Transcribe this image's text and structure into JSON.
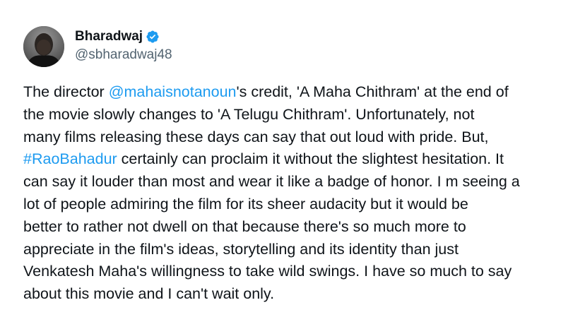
{
  "author": {
    "display_name": "Bharadwaj",
    "handle": "@sbharadwaj48",
    "verified_badge_icon": "verified-badge-icon",
    "avatar": "avatar-photo"
  },
  "tweet": {
    "lines": [
      [
        "The director ",
        "@mahaisnotanoun",
        "'s credit, 'A Maha Chithram' at the end of"
      ],
      [
        "the movie slowly changes to 'A Telugu Chithram'. Unfortunately, not"
      ],
      [
        "many films releasing these days can say that out loud with pride. But,"
      ],
      [
        "#RaoBahadur",
        " certainly can proclaim it without the slightest hesitation. It"
      ],
      [
        "can say it louder than most and wear it like a badge of honor. I m seeing a"
      ],
      [
        "lot of people admiring the film for its sheer audacity but it would be"
      ],
      [
        "better to rather not dwell on that because there's so much more to"
      ],
      [
        "appreciate in the film's ideas, storytelling and its identity than just"
      ],
      [
        "Venkatesh Maha's willingness to take wild swings. I have so much to say"
      ],
      [
        "about this movie and I can't wait only."
      ]
    ]
  },
  "colors": {
    "link": "#1d9bf0",
    "text": "#0f1419",
    "muted": "#536471",
    "verified": "#1d9bf0"
  }
}
